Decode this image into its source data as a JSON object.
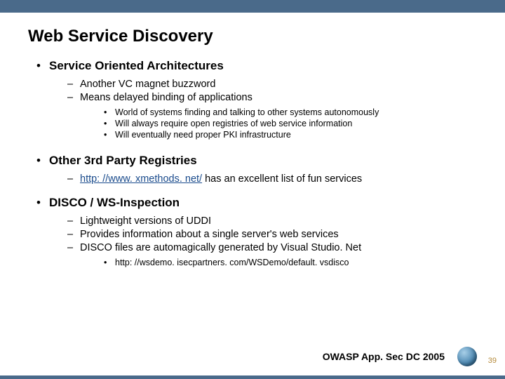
{
  "title": "Web Service Discovery",
  "sections": [
    {
      "label": "Service Oriented Architectures",
      "items": [
        {
          "text": "Another VC magnet buzzword"
        },
        {
          "text": "Means delayed binding of applications",
          "sub": [
            "World of systems finding and talking to other systems autonomously",
            "Will always require open registries of web service information",
            "Will eventually need proper PKI infrastructure"
          ]
        }
      ]
    },
    {
      "label": "Other 3rd Party Registries",
      "items": [
        {
          "link": "http: //www. xmethods. net/",
          "tail": " has an excellent list of fun services"
        }
      ]
    },
    {
      "label": "DISCO / WS-Inspection",
      "items": [
        {
          "text": "Lightweight versions of UDDI"
        },
        {
          "text": "Provides information about a single server's web services"
        },
        {
          "text": "DISCO files are automagically generated by Visual Studio. Net",
          "sub": [
            "http: //wsdemo. isecpartners. com/WSDemo/default. vsdisco"
          ]
        }
      ]
    }
  ],
  "footer": "OWASP App. Sec DC 2005",
  "page_number": "39"
}
